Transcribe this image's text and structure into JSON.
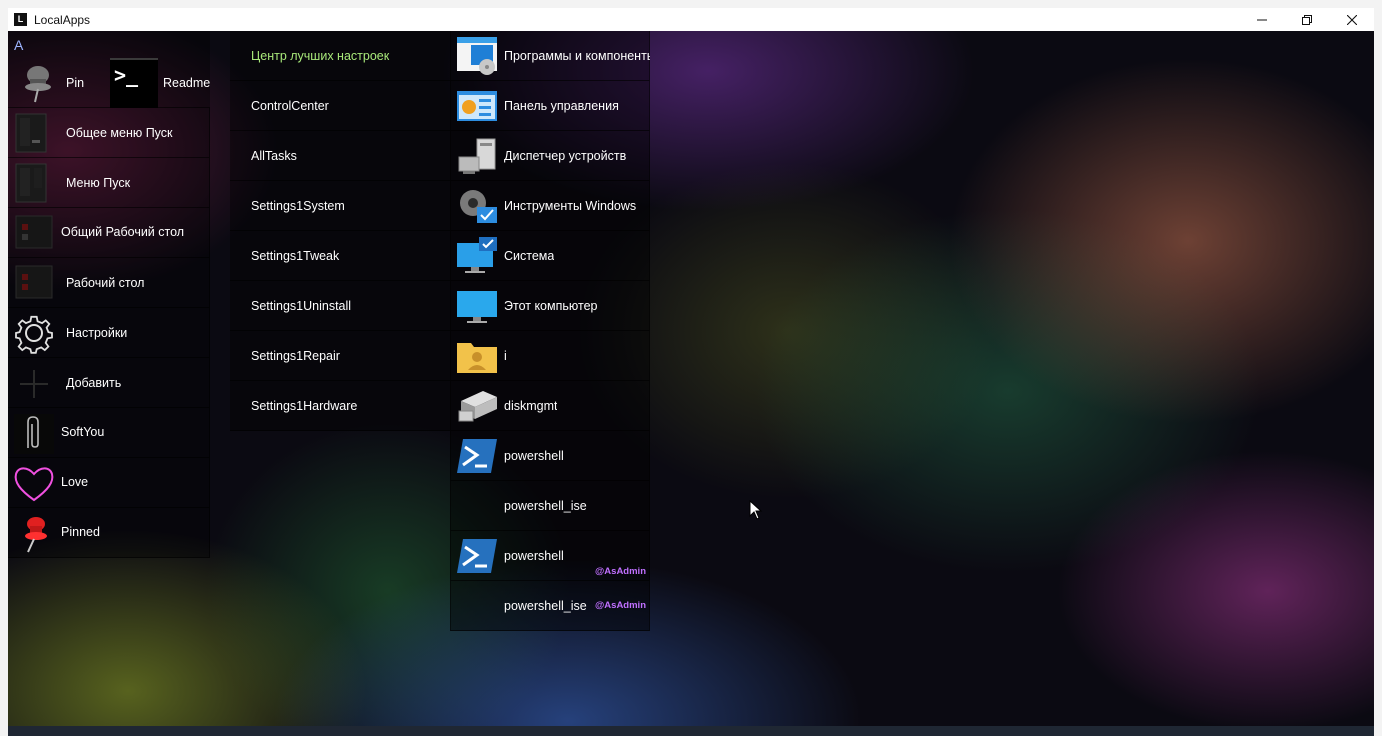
{
  "window": {
    "title": "LocalApps",
    "logo_glyph": "L"
  },
  "col1": {
    "letter": "A",
    "pin_label": "Pin",
    "readme_glyph": ">_",
    "readme_label": "Readme",
    "items": [
      {
        "label": "Общее меню Пуск",
        "icon": "start-menu-icon"
      },
      {
        "label": "Меню Пуск",
        "icon": "start-menu-icon"
      },
      {
        "label": "Общий Рабочий стол",
        "icon": "desktop-icon"
      },
      {
        "label": "Рабочий стол",
        "icon": "desktop-icon"
      },
      {
        "label": "Настройки",
        "icon": "gear-icon"
      },
      {
        "label": "Добавить",
        "icon": "plus-icon"
      },
      {
        "label": "SoftYou",
        "icon": "paperclip-icon"
      },
      {
        "label": "Love",
        "icon": "heart-icon"
      },
      {
        "label": "Pinned",
        "icon": "pushpin-icon"
      }
    ]
  },
  "col2": {
    "items": [
      {
        "label": "Центр лучших настроек",
        "color": "#a8e87a"
      },
      {
        "label": "ControlCenter"
      },
      {
        "label": "AllTasks"
      },
      {
        "label": "Settings1System"
      },
      {
        "label": "Settings1Tweak"
      },
      {
        "label": "Settings1Uninstall"
      },
      {
        "label": "Settings1Repair"
      },
      {
        "label": "Settings1Hardware"
      }
    ]
  },
  "col3": {
    "items": [
      {
        "label": "Программы и компоненты",
        "icon": "programs-icon"
      },
      {
        "label": "Панель управления",
        "icon": "control-panel-icon"
      },
      {
        "label": "Диспетчер устройств",
        "icon": "device-manager-icon"
      },
      {
        "label": "Инструменты Windows",
        "icon": "windows-tools-icon"
      },
      {
        "label": "Система",
        "icon": "system-icon"
      },
      {
        "label": "Этот компьютер",
        "icon": "this-pc-icon"
      },
      {
        "label": "i",
        "icon": "user-folder-icon"
      },
      {
        "label": "diskmgmt",
        "icon": "disk-icon"
      },
      {
        "label": "powershell",
        "icon": "powershell-icon"
      },
      {
        "label": "powershell_ise",
        "icon": ""
      },
      {
        "label": "powershell",
        "icon": "powershell-icon",
        "badge": "@AsAdmin"
      },
      {
        "label": "powershell_ise",
        "icon": "",
        "badge": "@AsAdmin"
      }
    ]
  }
}
